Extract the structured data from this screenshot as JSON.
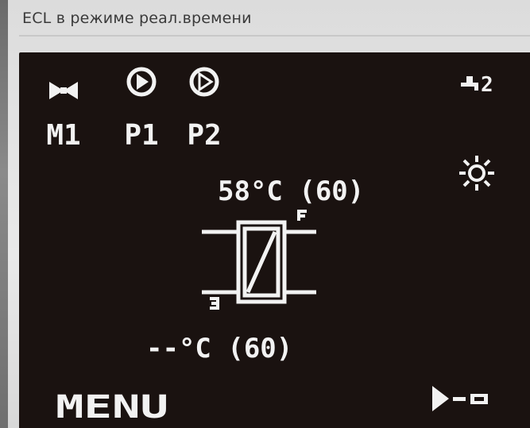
{
  "window": {
    "title": "ECL в режиме реал.времени"
  },
  "panel": {
    "components": [
      {
        "label": "M1",
        "icon": "valve-icon"
      },
      {
        "label": "P1",
        "icon": "pump-icon"
      },
      {
        "label": "P2",
        "icon": "pump-icon"
      }
    ],
    "tap_indicator": "2",
    "supply_temperature": "58°C (60)",
    "return_temperature": "--°C (60)",
    "menu_label": "MENU",
    "mode_icon": "sun-icon",
    "heat_exchanger_icon": "heat-exchanger-icon",
    "nav_icon": "arrow-right-icon"
  },
  "colors": {
    "screen_background": "#1a1210",
    "lcd_foreground": "#f2f2f2",
    "window_background": "#e4e4e4"
  }
}
